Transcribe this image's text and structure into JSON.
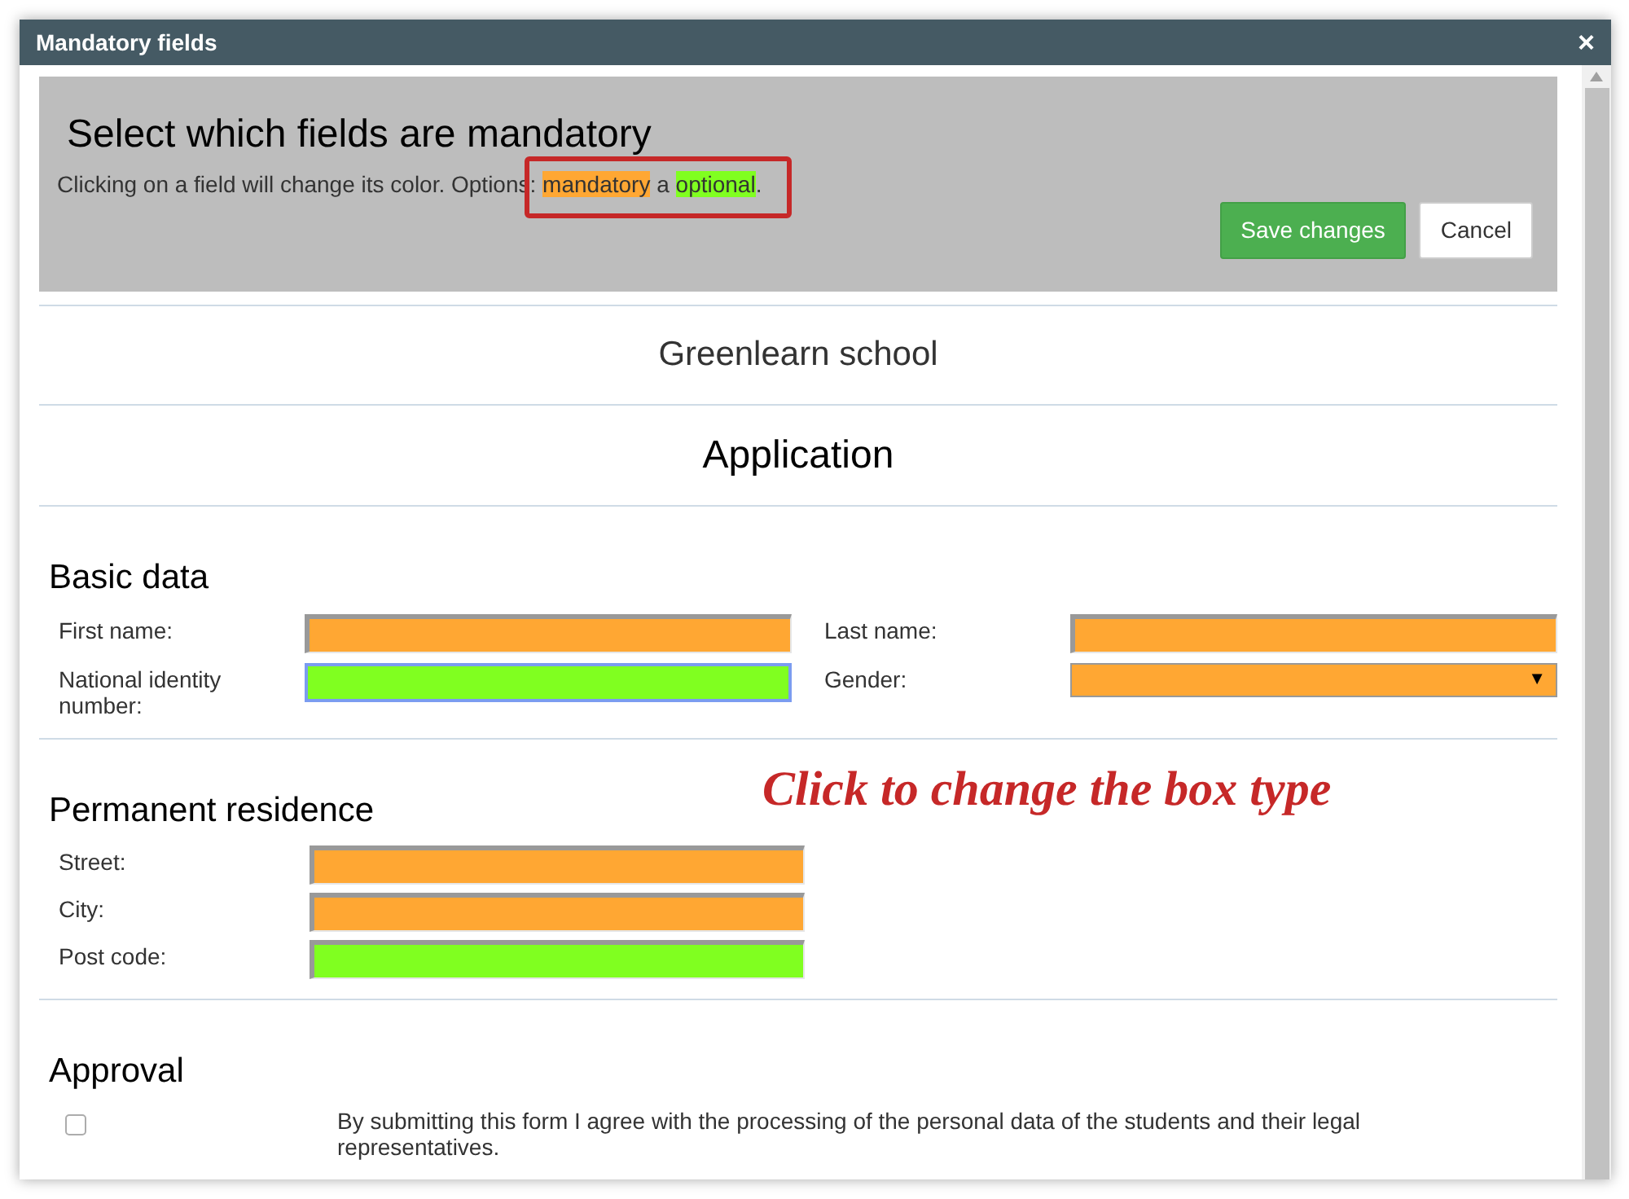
{
  "window": {
    "title": "Mandatory fields",
    "close": "×"
  },
  "header": {
    "title": "Select which fields are mandatory",
    "intro": {
      "text": "Clicking on a field will change its color. Options:",
      "mandatory_label": "mandatory",
      "joiner": "a",
      "optional_label": "optional",
      "end": "."
    },
    "buttons": [
      {
        "label": "Save changes",
        "kind": "primary"
      },
      {
        "label": "Cancel",
        "kind": "default"
      }
    ]
  },
  "school": "Greenlearn school",
  "form_title": "Application",
  "annotation": "Click to change the box type",
  "sections": [
    {
      "title": "Basic data",
      "kind": "two_column",
      "fields": [
        {
          "label": "First name:",
          "kind": "text",
          "mandatory": true,
          "focused": false
        },
        {
          "label": "Last name:",
          "kind": "text",
          "mandatory": true,
          "focused": false
        },
        {
          "label": "National identity number:",
          "kind": "text",
          "mandatory": false,
          "focused": true
        },
        {
          "label": "Gender:",
          "kind": "select",
          "mandatory": true,
          "focused": false,
          "caret": "▼"
        }
      ]
    },
    {
      "title": "Permanent residence",
      "kind": "stacked",
      "fields": [
        {
          "label": "Street:",
          "kind": "text",
          "mandatory": true,
          "focused": false
        },
        {
          "label": "City:",
          "kind": "text",
          "mandatory": true,
          "focused": false
        },
        {
          "label": "Post code:",
          "kind": "text",
          "mandatory": false,
          "focused": false
        }
      ]
    },
    {
      "title": "Approval",
      "kind": "stacked",
      "fields": [
        {
          "label": "By submitting this form I agree with the processing of the personal data of the students and their legal representatives.",
          "kind": "checkbox",
          "checked": false
        }
      ]
    }
  ]
}
